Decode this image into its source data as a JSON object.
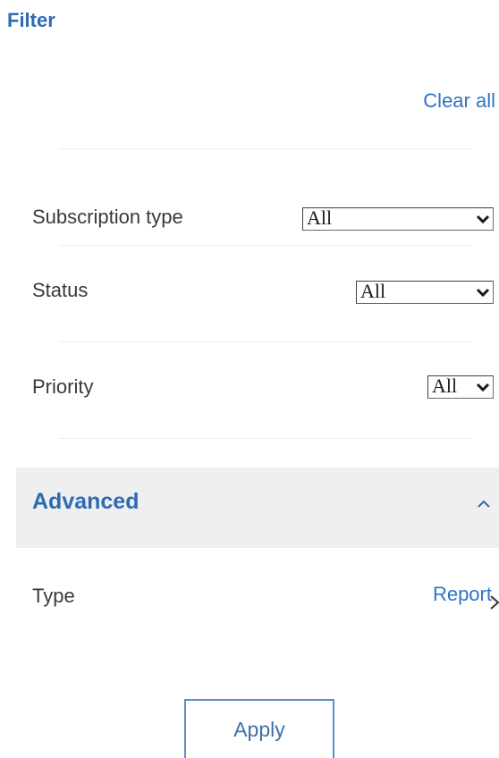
{
  "header": {
    "title": "Filter",
    "clear_all": "Clear all"
  },
  "filters": [
    {
      "label": "Subscription type",
      "value": "All"
    },
    {
      "label": "Status",
      "value": "All"
    },
    {
      "label": "Priority",
      "value": "All"
    }
  ],
  "advanced": {
    "title": "Advanced",
    "expanded": true,
    "type_label": "Type",
    "type_value": "Report"
  },
  "footer": {
    "apply_label": "Apply"
  },
  "colors": {
    "accent": "#2c6bb3",
    "link": "#2f74c0",
    "section_bg": "#efefef"
  },
  "icons": {
    "dropdown": "chevron-down-icon",
    "collapse": "chevron-up-icon",
    "navigate": "chevron-right-icon"
  }
}
